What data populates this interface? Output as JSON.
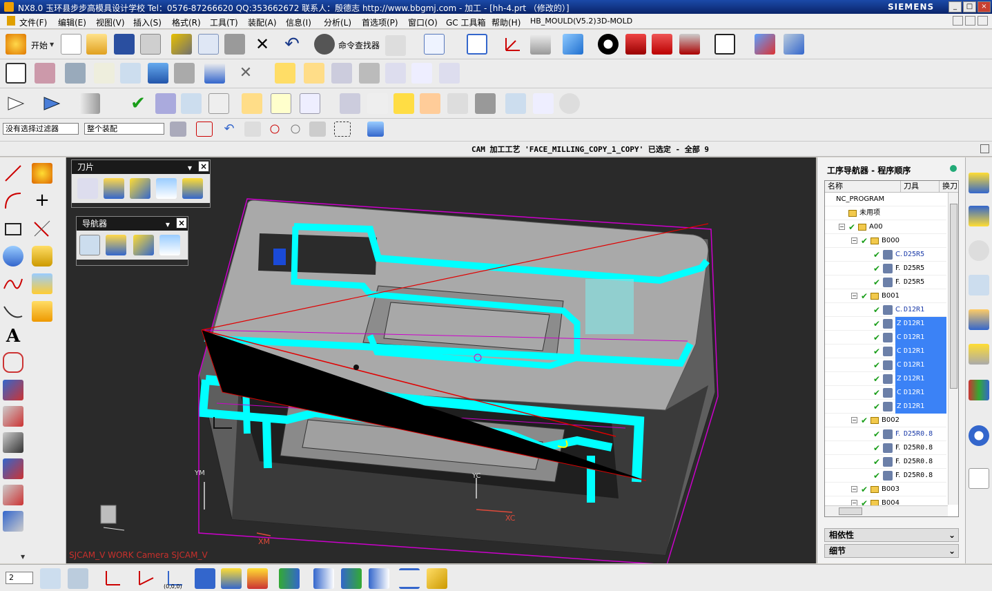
{
  "titlebar": {
    "title": "NX8.0 玉环县步步高模具设计学校 Tel：0576-87266620 QQ:353662672 联系人：殷德志 http://www.bbgmj.com - 加工 - [hh-4.prt （修改的）]",
    "brand": "SIEMENS",
    "min_label": "_",
    "max_label": "□",
    "close_label": "×"
  },
  "menu": {
    "items": [
      "文件(F)",
      "编辑(E)",
      "视图(V)",
      "插入(S)",
      "格式(R)",
      "工具(T)",
      "装配(A)",
      "信息(I)",
      "分析(L)",
      "首选项(P)",
      "窗口(O)",
      "GC 工具箱",
      "帮助(H)",
      "HB_MOULD(V5.2)",
      "3D-MOLD"
    ]
  },
  "toolbar1": {
    "start_label": "开始",
    "find_label": "命令查找器"
  },
  "filters": {
    "selection_filter": "没有选择过滤器",
    "scope": "整个装配"
  },
  "status": {
    "text": "CAM 加工工艺 'FACE_MILLING_COPY_1_COPY' 已选定 - 全部 9"
  },
  "panels": {
    "tool_panel_title": "刀片",
    "navigator_panel_title": "导航器"
  },
  "viewport": {
    "label": "SJCAM_V WORK Camera SJCAM_V",
    "axis_labels": {
      "ym": "YM",
      "yc": "YC",
      "xc": "XC",
      "xm": "XM"
    }
  },
  "navigator": {
    "title": "工序导航器 - 程序顺序",
    "columns": [
      "名称",
      "刀具",
      "换刀"
    ],
    "rows": [
      {
        "indent": 0,
        "name": "NC_PROGRAM",
        "tool": "",
        "kind": "root"
      },
      {
        "indent": 1,
        "name": "未用项",
        "tool": "",
        "kind": "folder"
      },
      {
        "indent": 1,
        "name": "A00",
        "tool": "",
        "kind": "group"
      },
      {
        "indent": 2,
        "name": "B000",
        "tool": "",
        "kind": "group"
      },
      {
        "indent": 3,
        "name": "C.",
        "tool": "D25R5",
        "kind": "op",
        "blue": true
      },
      {
        "indent": 3,
        "name": "F.",
        "tool": "D25R5",
        "kind": "op"
      },
      {
        "indent": 3,
        "name": "F.",
        "tool": "D25R5",
        "kind": "op"
      },
      {
        "indent": 2,
        "name": "B001",
        "tool": "",
        "kind": "group"
      },
      {
        "indent": 3,
        "name": "C.",
        "tool": "D12R1",
        "kind": "op",
        "blue": true
      },
      {
        "indent": 3,
        "name": "Z.",
        "tool": "D12R1",
        "kind": "op",
        "sel": true
      },
      {
        "indent": 3,
        "name": "C.",
        "tool": "D12R1",
        "kind": "op",
        "sel": true
      },
      {
        "indent": 3,
        "name": "C.",
        "tool": "D12R1",
        "kind": "op",
        "sel": true
      },
      {
        "indent": 3,
        "name": "C.",
        "tool": "D12R1",
        "kind": "op",
        "sel": true
      },
      {
        "indent": 3,
        "name": "Z.",
        "tool": "D12R1",
        "kind": "op",
        "sel": true
      },
      {
        "indent": 3,
        "name": "C.",
        "tool": "D12R1",
        "kind": "op",
        "sel": true
      },
      {
        "indent": 3,
        "name": "Z.",
        "tool": "D12R1",
        "kind": "op",
        "sel": true
      },
      {
        "indent": 2,
        "name": "B002",
        "tool": "",
        "kind": "group"
      },
      {
        "indent": 3,
        "name": "F.",
        "tool": "D25R0.8",
        "kind": "op",
        "blue": true
      },
      {
        "indent": 3,
        "name": "F.",
        "tool": "D25R0.8",
        "kind": "op"
      },
      {
        "indent": 3,
        "name": "F.",
        "tool": "D25R0.8",
        "kind": "op"
      },
      {
        "indent": 3,
        "name": "F.",
        "tool": "D25R0.8",
        "kind": "op"
      },
      {
        "indent": 2,
        "name": "B003",
        "tool": "",
        "kind": "group"
      },
      {
        "indent": 2,
        "name": "B004",
        "tool": "",
        "kind": "group"
      }
    ],
    "sections": [
      "相依性",
      "细节"
    ]
  },
  "bottom": {
    "layer_value": "2",
    "origin_label": "(0,0,0)"
  },
  "colors": {
    "accent": "#3b82f6",
    "toolpath": "#00ffff",
    "bound": "#cc00cc",
    "viewport_bg": "#2a2a2a"
  }
}
